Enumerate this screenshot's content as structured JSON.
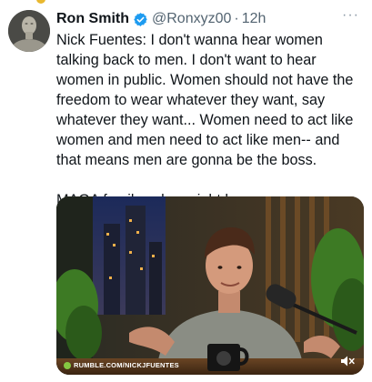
{
  "tweet": {
    "display_name": "Ron Smith",
    "handle": "@Ronxyz00",
    "separator": "·",
    "time": "12h",
    "more_label": "···",
    "text": "Nick Fuentes: I don't wanna hear women talking back to men. I don't want to hear women in public. Women should not have the freedom to wear whatever they want, say whatever they want... Women need to act like women and men need to act like men-- and that means men are gonna be the boss.\n\nMAGA family values right here.",
    "media": {
      "watermark": "RUMBLE.COM/NICKJFUENTES",
      "mug_logo": "AF"
    }
  },
  "colors": {
    "verified": "#1d9bf0",
    "secondary_text": "#536471",
    "rumble_green": "#85c742"
  },
  "icons": {
    "verified": "verified-badge-icon",
    "more": "more-options-icon",
    "mute": "volume-muted-icon",
    "rumble": "rumble-logo-icon"
  }
}
